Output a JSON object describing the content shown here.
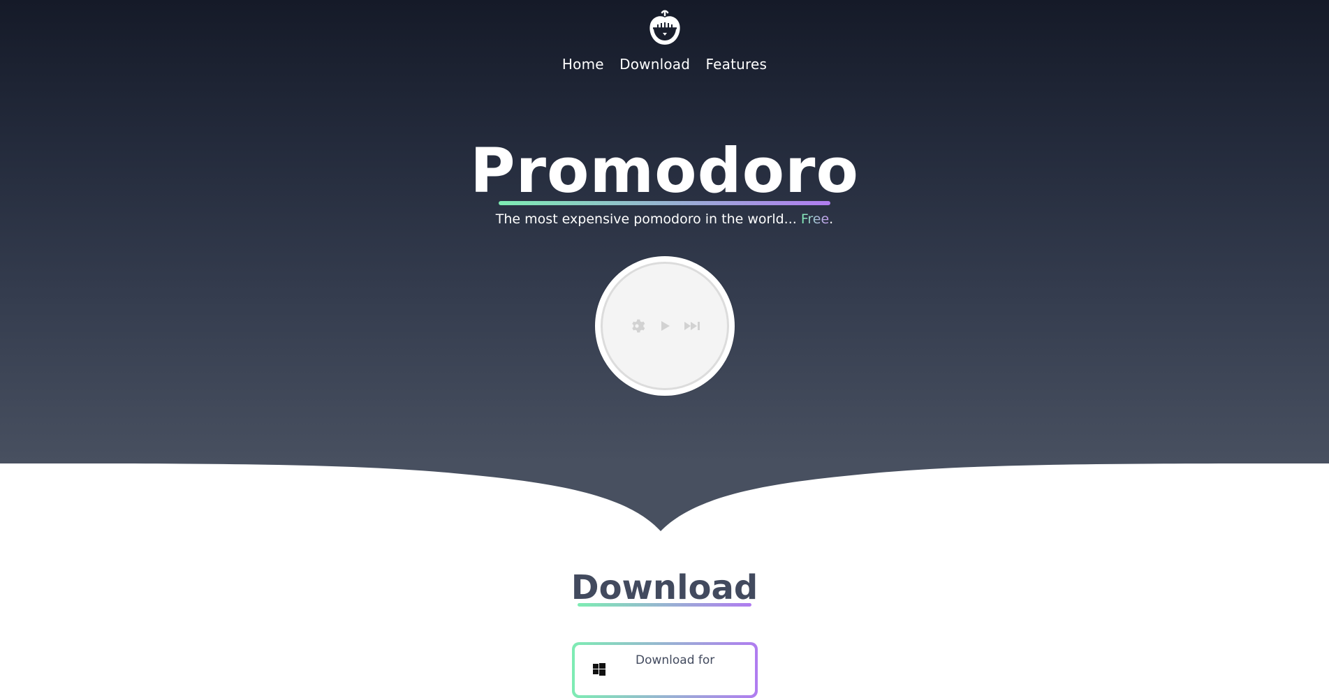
{
  "nav": {
    "items": [
      {
        "label": "Home"
      },
      {
        "label": "Download"
      },
      {
        "label": "Features"
      }
    ]
  },
  "hero": {
    "title": "Promodoro",
    "tagline_prefix": "The most expensive pomodoro in the world... ",
    "tagline_highlight": "Free",
    "tagline_suffix": "."
  },
  "timer": {
    "icons": [
      "gear-icon",
      "play-icon",
      "fast-forward-icon"
    ]
  },
  "download": {
    "title": "Download",
    "card_label": "Download for"
  },
  "colors": {
    "hero_top": "#151a28",
    "hero_bottom": "#485060",
    "gradient_start": "#7eecb3",
    "gradient_end": "#b07cf0",
    "heading_dark": "#424a5e"
  }
}
